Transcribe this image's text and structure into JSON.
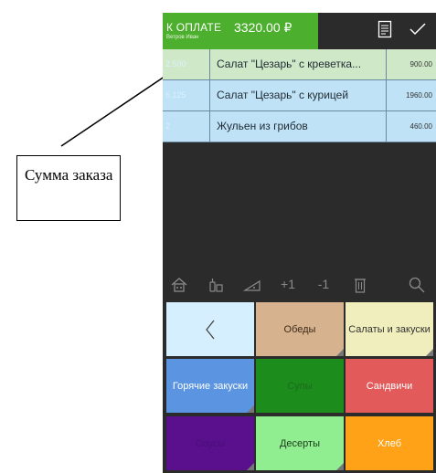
{
  "header": {
    "pay_label": "К ОПЛАТЕ",
    "customer": "Ветров Иван",
    "amount": "3320.00 ₽",
    "icons": [
      "receipt-icon",
      "check-icon"
    ]
  },
  "order_items": [
    {
      "qty": "2.500",
      "name": "Салат \"Цезарь\" с креветка...",
      "price": "900.00",
      "bg": "#cfe9c8"
    },
    {
      "qty": "6.125",
      "name": "Салат \"Цезарь\" с курицей",
      "price": "1960.00",
      "bg": "#bfe2f6"
    },
    {
      "qty": "2",
      "name": "Жульен из грибов",
      "price": "460.00",
      "bg": "#bfe2f6"
    }
  ],
  "toolbar": {
    "plus_one": "+1",
    "minus_one": "-1",
    "icons": [
      "home-icon",
      "bottles-icon",
      "slice-icon",
      "trash-icon",
      "search-icon"
    ]
  },
  "categories": [
    {
      "label": "‹",
      "bg": "#d6efff",
      "color": "#333",
      "is_back": true
    },
    {
      "label": "Обеды",
      "bg": "#d6b38e",
      "color": "#3b2a1a"
    },
    {
      "label": "Салаты и закуски",
      "bg": "#f0eebc",
      "color": "#333"
    },
    {
      "label": "Горячие закуски",
      "bg": "#5b94e0",
      "color": "#ffffff"
    },
    {
      "label": "Супы",
      "bg": "#1c8c1c",
      "color": "#1e6b1e"
    },
    {
      "label": "Сандвичи",
      "bg": "#e25a5a",
      "color": "#ffffff"
    },
    {
      "label": "Соусы",
      "bg": "#5a0f8c",
      "color": "#4a0f78"
    },
    {
      "label": "Десерты",
      "bg": "#90ee90",
      "color": "#1c3a1c"
    },
    {
      "label": "Хлеб",
      "bg": "#ffa218",
      "color": "#ffffff"
    }
  ],
  "annotation": {
    "text": "Сумма заказа"
  }
}
